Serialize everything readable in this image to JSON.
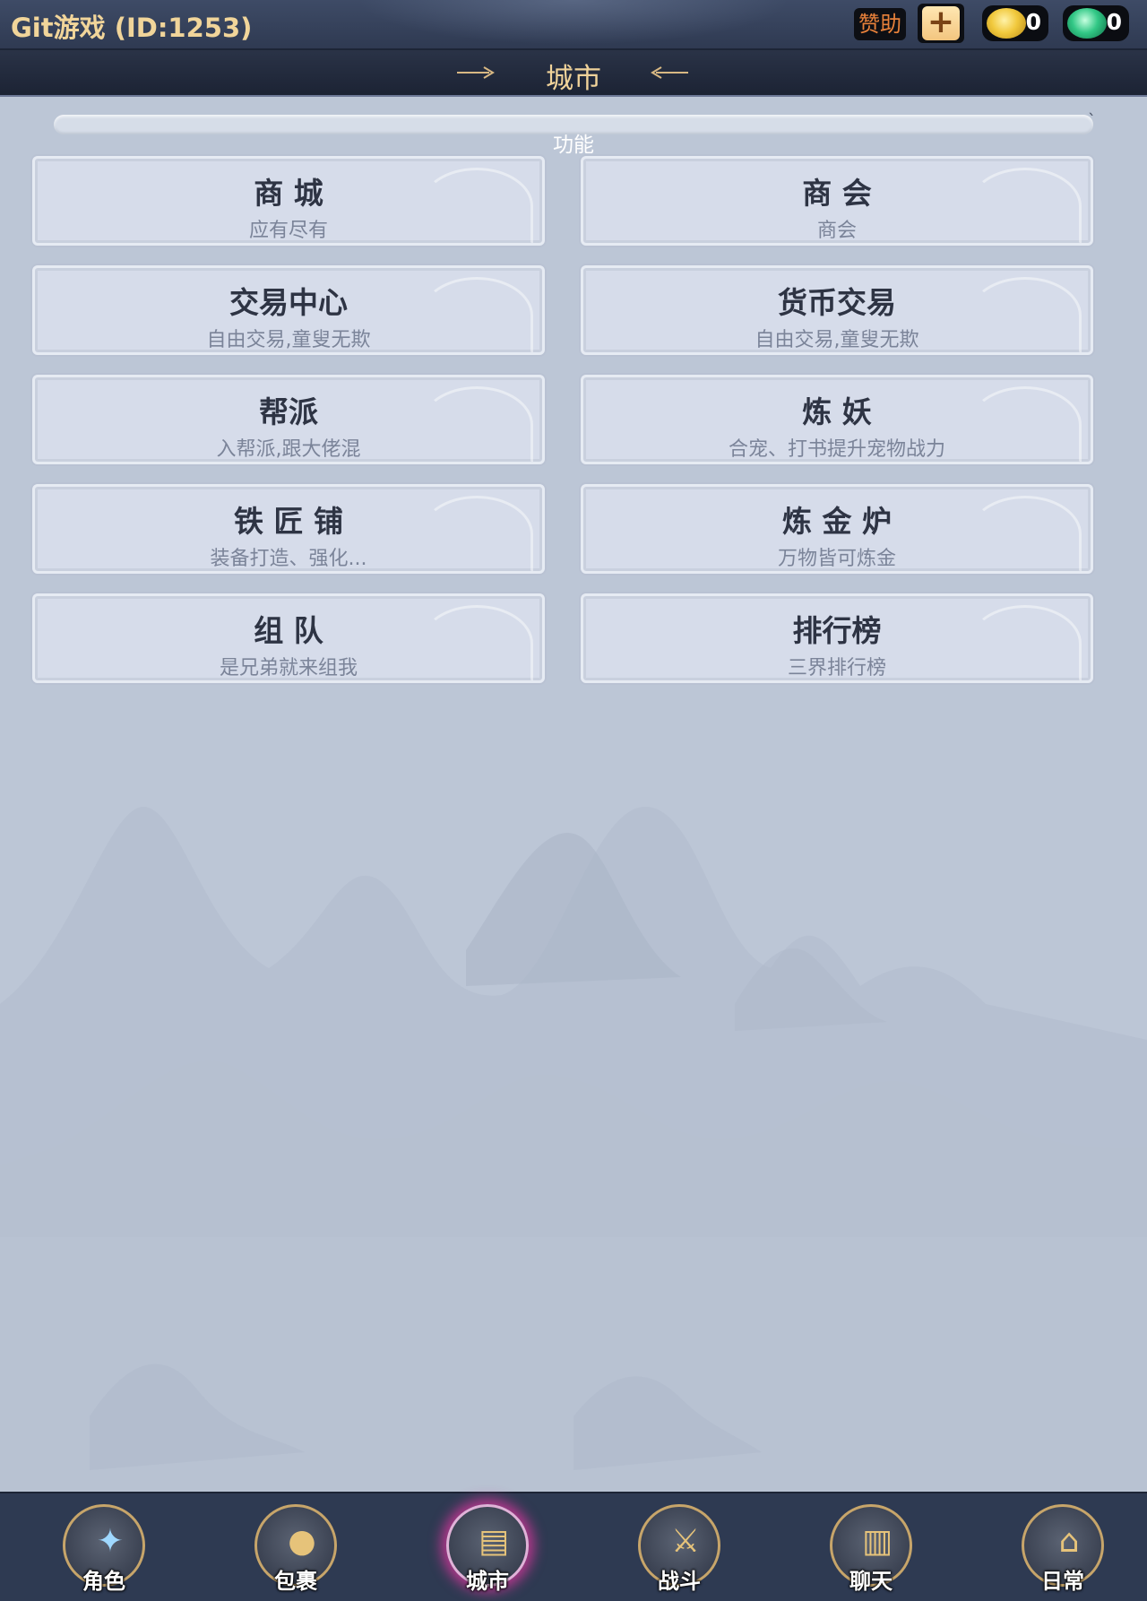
{
  "topbar": {
    "title": "Git游戏 (ID:1253)",
    "sponsor_label": "赞助",
    "plus_label": "+",
    "gold_value": "0",
    "jade_value": "0"
  },
  "header": {
    "title": "城市"
  },
  "section": {
    "label": "功能"
  },
  "cards": [
    {
      "title": "商 城",
      "subtitle": "应有尽有"
    },
    {
      "title": "商 会",
      "subtitle": "商会"
    },
    {
      "title": "交易中心",
      "subtitle": "自由交易,童叟无欺"
    },
    {
      "title": "货币交易",
      "subtitle": "自由交易,童叟无欺"
    },
    {
      "title": "帮派",
      "subtitle": "入帮派,跟大佬混"
    },
    {
      "title": "炼 妖",
      "subtitle": "合宠、打书提升宠物战力"
    },
    {
      "title": "铁 匠 铺",
      "subtitle": "装备打造、强化..."
    },
    {
      "title": "炼 金 炉",
      "subtitle": "万物皆可炼金"
    },
    {
      "title": "组 队",
      "subtitle": "是兄弟就来组我"
    },
    {
      "title": "排行榜",
      "subtitle": "三界排行榜"
    }
  ],
  "nav": [
    {
      "label": "角色",
      "icon": "character-icon"
    },
    {
      "label": "包裹",
      "icon": "bag-icon"
    },
    {
      "label": "城市",
      "icon": "city-icon"
    },
    {
      "label": "战斗",
      "icon": "battle-icon"
    },
    {
      "label": "聊天",
      "icon": "chat-icon"
    },
    {
      "label": "日常",
      "icon": "daily-icon"
    }
  ],
  "colors": {
    "accent_gold": "#f1d59a",
    "active_glow": "#e236a0",
    "background": "#bcc6d6"
  }
}
